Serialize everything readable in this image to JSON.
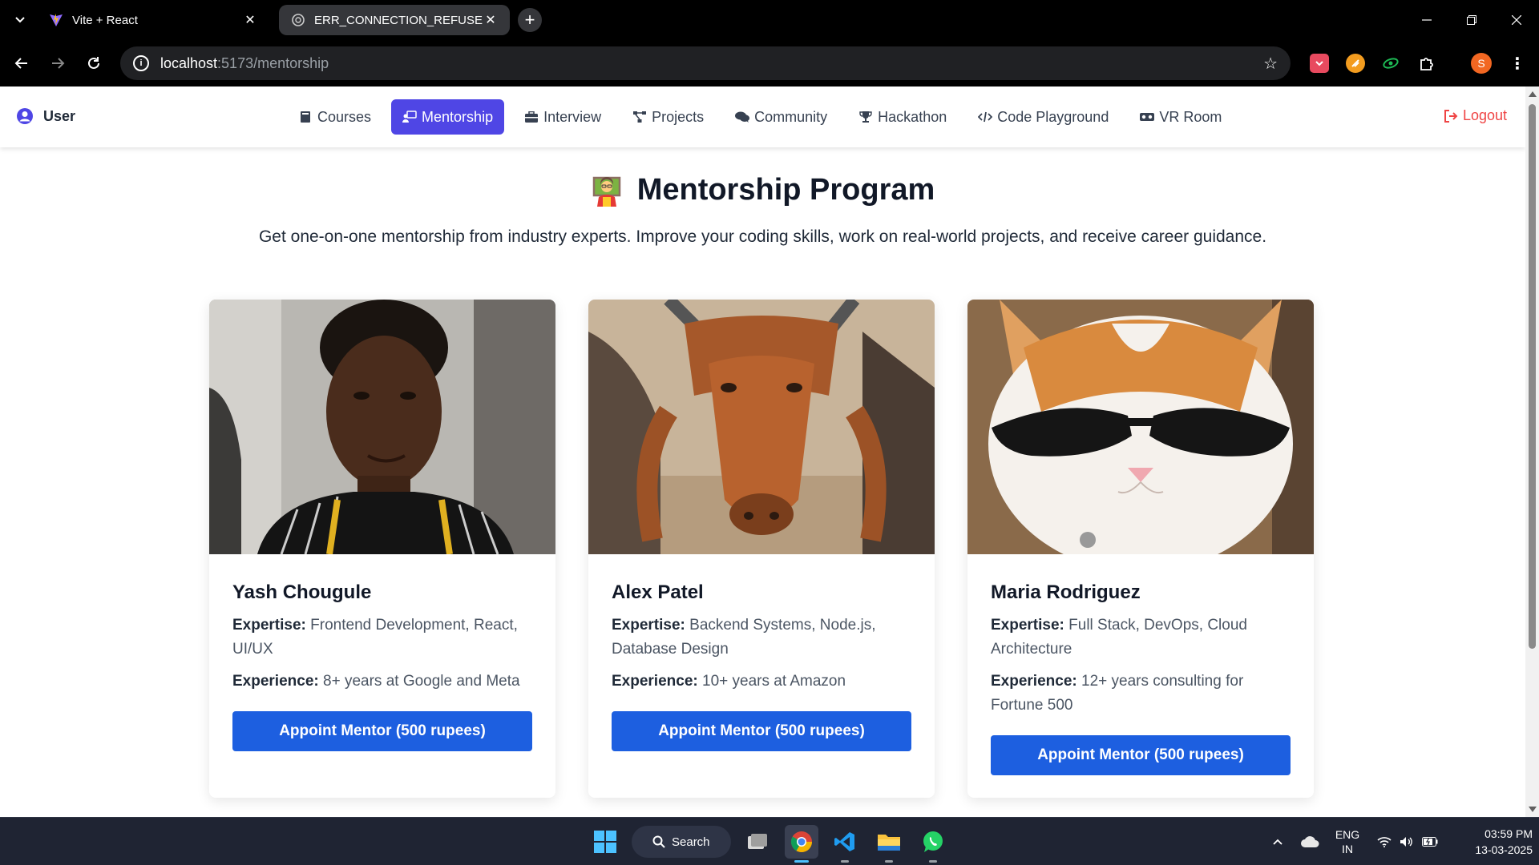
{
  "browser": {
    "tabs": [
      {
        "title": "Vite + React",
        "active": false
      },
      {
        "title": "ERR_CONNECTION_REFUSED Tr",
        "active": true
      }
    ],
    "url_host": "localhost",
    "url_path": ":5173/mentorship"
  },
  "app": {
    "user_label": "User",
    "nav": [
      {
        "label": "Courses",
        "icon": "book-icon"
      },
      {
        "label": "Mentorship",
        "icon": "mentor-icon",
        "active": true
      },
      {
        "label": "Interview",
        "icon": "briefcase-icon"
      },
      {
        "label": "Projects",
        "icon": "project-diagram-icon"
      },
      {
        "label": "Community",
        "icon": "comments-icon"
      },
      {
        "label": "Hackathon",
        "icon": "trophy-icon"
      },
      {
        "label": "Code Playground",
        "icon": "code-icon"
      },
      {
        "label": "VR Room",
        "icon": "vr-headset-icon"
      }
    ],
    "logout_label": "Logout",
    "accent_color": "#4f46e5",
    "button_color": "#1d5fe0",
    "logout_color": "#ef4444"
  },
  "page": {
    "title": "Mentorship Program",
    "title_icon": "teacher-emoji-icon",
    "subtitle": "Get one-on-one mentorship from industry experts. Improve your coding skills, work on real-world projects, and receive career guidance."
  },
  "mentors": [
    {
      "name": "Yash Chougule",
      "photo": "mentor-photo-person",
      "expertise_label": "Expertise:",
      "expertise": "Frontend Development, React, UI/UX",
      "experience_label": "Experience:",
      "experience": "8+ years at Google and Meta",
      "button": "Appoint Mentor (500 rupees)"
    },
    {
      "name": "Alex Patel",
      "photo": "mentor-photo-cow",
      "expertise_label": "Expertise:",
      "expertise": "Backend Systems, Node.js, Database Design",
      "experience_label": "Experience:",
      "experience": "10+ years at Amazon",
      "button": "Appoint Mentor (500 rupees)"
    },
    {
      "name": "Maria Rodriguez",
      "photo": "mentor-photo-cat-sunglasses",
      "expertise_label": "Expertise:",
      "expertise": "Full Stack, DevOps, Cloud Architecture",
      "experience_label": "Experience:",
      "experience": "12+ years consulting for Fortune 500",
      "button": "Appoint Mentor (500 rupees)"
    }
  ],
  "taskbar": {
    "search_label": "Search",
    "lang_line1": "ENG",
    "lang_line2": "IN",
    "time": "03:59 PM",
    "date": "13-03-2025"
  }
}
